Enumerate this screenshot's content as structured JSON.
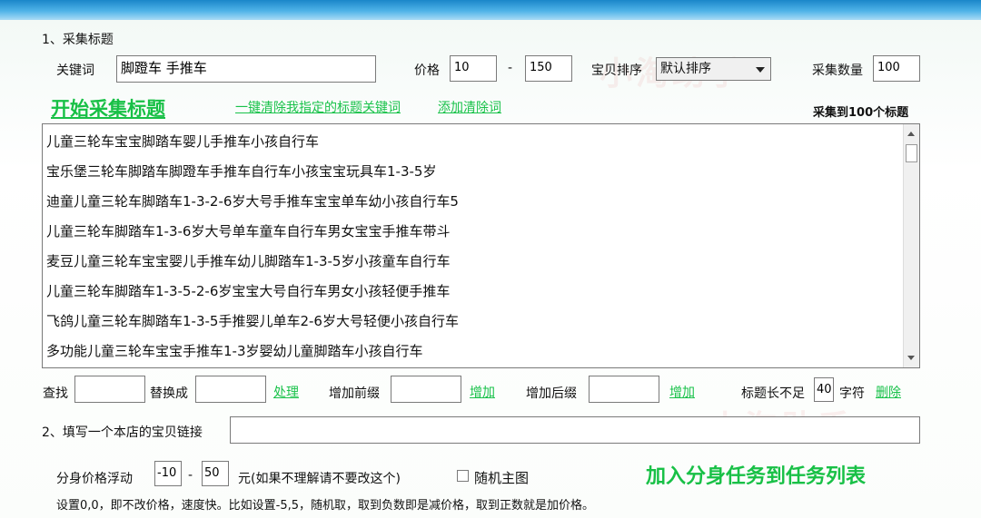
{
  "section1": {
    "title": "1、采集标题",
    "keyword_label": "关键词",
    "keyword_value": "脚蹬车 手推车",
    "price_label": "价格",
    "price_min": "10",
    "price_sep": "-",
    "price_max": "150",
    "sort_label": "宝贝排序",
    "sort_value": "默认排序",
    "count_label": "采集数量",
    "count_value": "100",
    "start_button": "开始采集标题",
    "clear_link": "一键清除我指定的标题关键词",
    "add_clear_link": "添加清除词",
    "collected_status": "采集到100个标题"
  },
  "titles": [
    "儿童三轮车宝宝脚踏车婴儿手推车小孩自行车",
    "宝乐堡三轮车脚踏车脚蹬车手推车自行车小孩宝宝玩具车1-3-5岁",
    "迪童儿童三轮车脚踏车1-3-2-6岁大号手推车宝宝单车幼小孩自行车5",
    "儿童三轮车脚踏车1-3-6岁大号单车童车自行车男女宝宝手推车带斗",
    "麦豆儿童三轮车宝宝婴儿手推车幼儿脚踏车1-3-5岁小孩童车自行车",
    "儿童三轮车脚踏车1-3-5-2-6岁宝宝大号自行车男女小孩轻便手推车",
    "飞鸽儿童三轮车脚踏车1-3-5手推婴儿单车2-6岁大号轻便小孩自行车",
    "多功能儿童三轮车宝宝手推车1-3岁婴幼儿童脚踏车小孩自行车"
  ],
  "tools": {
    "find_label": "查找",
    "find_value": "",
    "replace_label": "替换成",
    "replace_value": "",
    "process_link": "处理",
    "prefix_label": "增加前缀",
    "prefix_value": "",
    "add_prefix_link": "增加",
    "suffix_label": "增加后缀",
    "suffix_value": "",
    "add_suffix_link": "增加",
    "shortlen_label": "标题长不足",
    "shortlen_value": "40",
    "char_label": "字符",
    "delete_link": "删除"
  },
  "section2": {
    "title": "2、填写一个本店的宝贝链接",
    "link_value": "",
    "float_label": "分身价格浮动",
    "float_min": "-10",
    "float_sep": "-",
    "float_max": "50",
    "float_note": "元(如果不理解请不要改这个)",
    "random_main_label": "随机主图",
    "add_task_button": "加入分身任务到任务列表",
    "hint": "设置0,0，即不改价格，速度快。比如设置-5,5，随机取，取到负数即是减价格，取到正数就是加价格。"
  },
  "watermark": [
    "小淘助手",
    "小淘助手"
  ]
}
